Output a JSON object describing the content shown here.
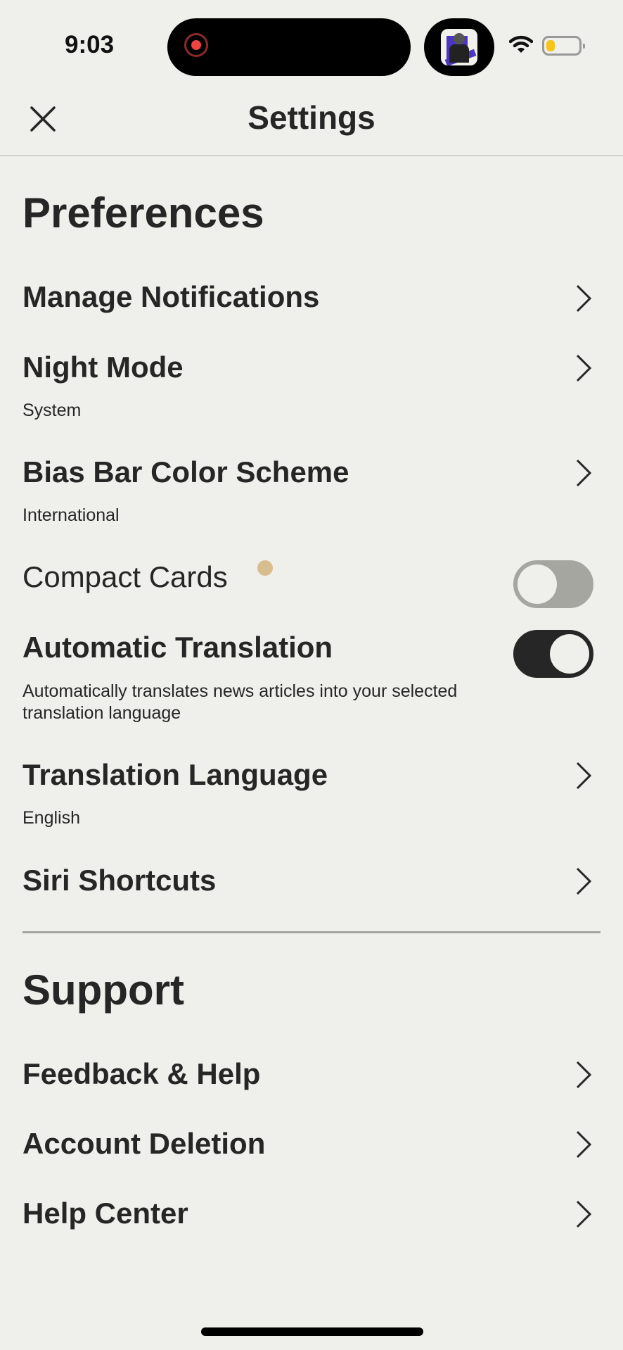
{
  "status_bar": {
    "time": "9:03",
    "recording_indicator": "record-icon",
    "live_activity": "app-thumbnail",
    "wifi": "wifi-icon",
    "battery": "battery-low-icon",
    "battery_color": "#f5c518"
  },
  "header": {
    "title": "Settings",
    "close_icon": "close-icon"
  },
  "preferences": {
    "heading": "Preferences",
    "items": [
      {
        "label": "Manage Notifications",
        "type": "link"
      },
      {
        "label": "Night Mode",
        "value": "System",
        "type": "link"
      },
      {
        "label": "Bias Bar Color Scheme",
        "value": "International",
        "type": "link"
      },
      {
        "label": "Compact Cards",
        "type": "toggle",
        "on": false,
        "new_badge": true,
        "badge_color": "#d8bd8e"
      },
      {
        "label": "Automatic Translation",
        "type": "toggle",
        "on": true,
        "description": "Automatically translates news articles into your selected",
        "description_2": "translation language"
      },
      {
        "label": "Translation Language",
        "value": "English",
        "type": "link"
      },
      {
        "label": "Siri Shortcuts",
        "type": "link"
      }
    ]
  },
  "support": {
    "heading": "Support",
    "items": [
      {
        "label": "Feedback & Help",
        "type": "link"
      },
      {
        "label": "Account Deletion",
        "type": "link"
      },
      {
        "label": "Help Center",
        "type": "link"
      }
    ]
  },
  "colors": {
    "background": "#efefeb",
    "text": "#262626",
    "toggle_on": "#262626",
    "toggle_off": "#a6a6a1"
  }
}
